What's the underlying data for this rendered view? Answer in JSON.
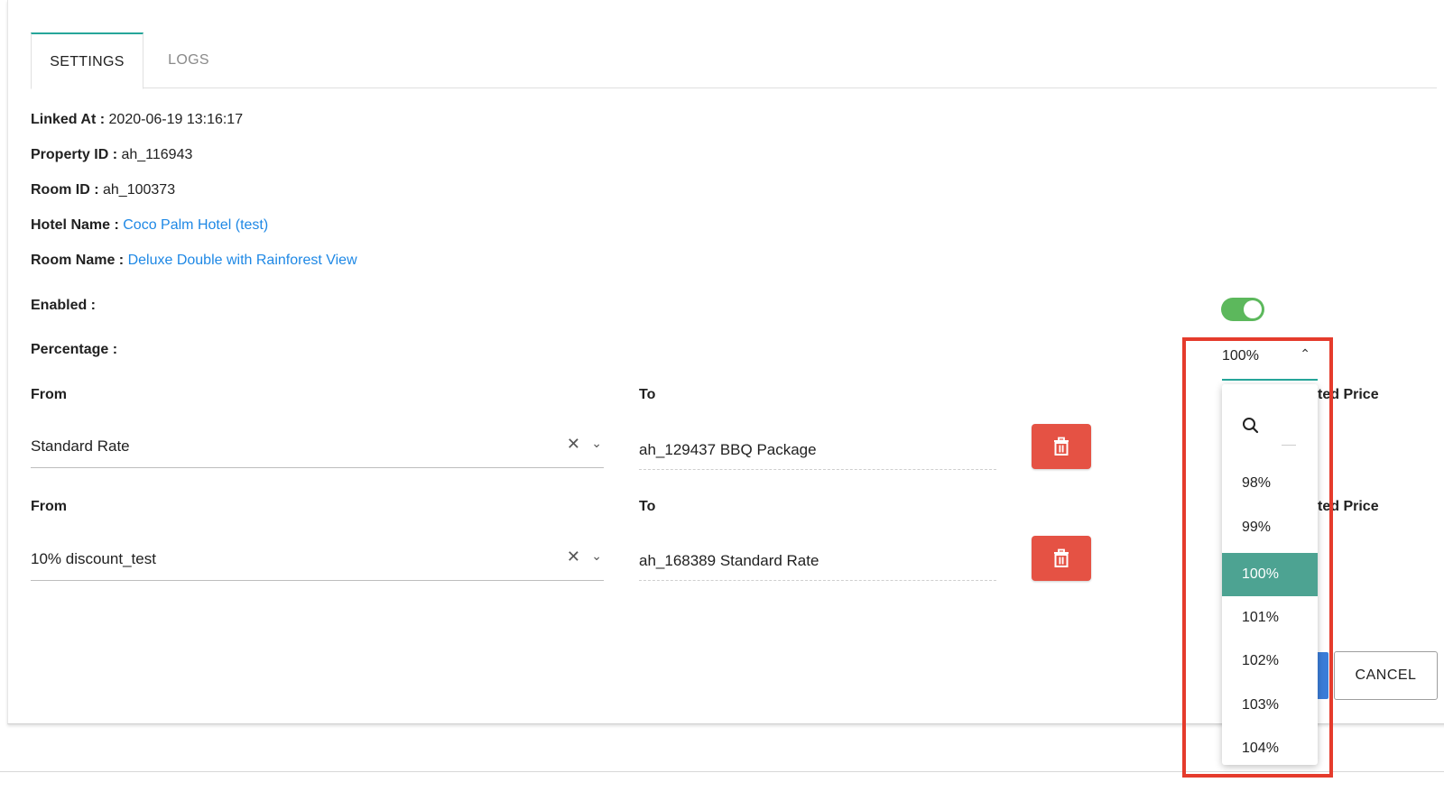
{
  "tabs": [
    {
      "label": "SETTINGS",
      "active": true
    },
    {
      "label": "LOGS",
      "active": false
    }
  ],
  "info": {
    "linked_at": {
      "label": "Linked At :",
      "value": "2020-06-19 13:16:17"
    },
    "property_id": {
      "label": "Property ID :",
      "value": "ah_116943"
    },
    "room_id": {
      "label": "Room ID :",
      "value": "ah_100373"
    },
    "hotel_name": {
      "label": "Hotel Name :",
      "value": "Coco Palm Hotel (test)"
    },
    "room_name": {
      "label": "Room Name :",
      "value": "Deluxe Double with Rainforest View"
    }
  },
  "enabled": {
    "label": "Enabled :",
    "value": true,
    "color": "#5cb85c"
  },
  "percentage": {
    "label": "Percentage :",
    "value": "100%"
  },
  "mappings": [
    {
      "from_label": "From",
      "from_value": "Standard Rate",
      "to_label": "To",
      "to_value": "ah_129437 BBQ Package",
      "side_label_partial": "ted Price"
    },
    {
      "from_label": "From",
      "from_value": "10% discount_test",
      "to_label": "To",
      "to_value": "ah_168389 Standard Rate",
      "side_label_partial": "ted Price"
    }
  ],
  "buttons": {
    "cancel": "CANCEL"
  },
  "dropdown": {
    "options": [
      "98%",
      "99%",
      "100%",
      "101%",
      "102%",
      "103%",
      "104%"
    ],
    "selected": "100%"
  },
  "colors": {
    "accent": "#26a69a",
    "selected_option": "#4da392",
    "delete": "#e55244",
    "link": "#1e88e5",
    "highlight": "#e53b2c"
  }
}
